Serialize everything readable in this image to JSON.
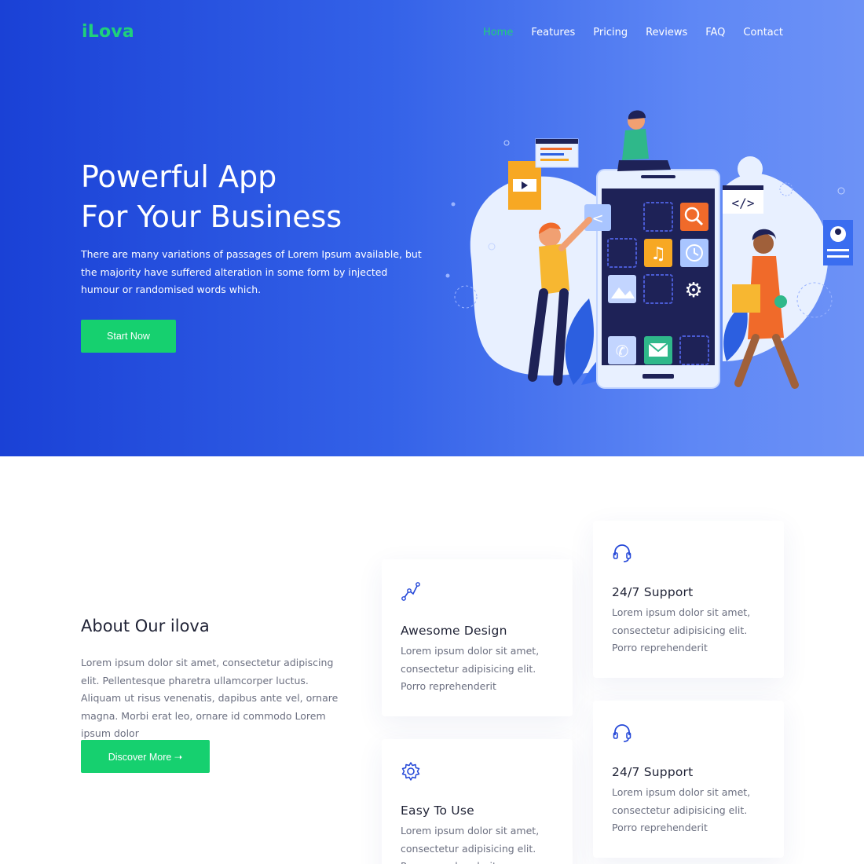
{
  "brand": {
    "logo": "iLova",
    "accent": "#16d06f"
  },
  "nav": {
    "items": [
      "Home",
      "Features",
      "Pricing",
      "Reviews",
      "FAQ",
      "Contact"
    ],
    "active": "Home"
  },
  "hero": {
    "title_line1": "Powerful App",
    "title_line2": "For Your Business",
    "text": "There are many variations of passages of Lorem Ipsum available, but the majority have suffered alteration in some form by injected humour or randomised words which.",
    "button": "Start Now",
    "gradient_start": "#1a41d6",
    "gradient_end": "#6d92f6"
  },
  "about": {
    "title": "About Our ilova",
    "text": "Lorem ipsum dolor sit amet, consectetur adipiscing elit. Pellentesque pharetra ullamcorper luctus. Aliquam ut risus venenatis, dapibus ante vel, ornare magna. Morbi erat leo, ornare id commodo Lorem ipsum dolor",
    "button": "Discover More ➝"
  },
  "features": [
    {
      "icon": "bezier-pen-icon",
      "title": "Awesome Design",
      "text": "Lorem ipsum dolor sit amet, consectetur adipisicing elit. Porro reprehenderit"
    },
    {
      "icon": "headset-icon",
      "title": "24/7 Support",
      "text": "Lorem ipsum dolor sit amet, consectetur adipisicing elit. Porro reprehenderit"
    },
    {
      "icon": "gear-icon",
      "title": "Easy To Use",
      "text": "Lorem ipsum dolor sit amet, consectetur adipisicing elit. Porro reprehenderit"
    },
    {
      "icon": "headset-icon",
      "title": "24/7 Support",
      "text": "Lorem ipsum dolor sit amet, consectetur adipisicing elit. Porro reprehenderit"
    }
  ]
}
